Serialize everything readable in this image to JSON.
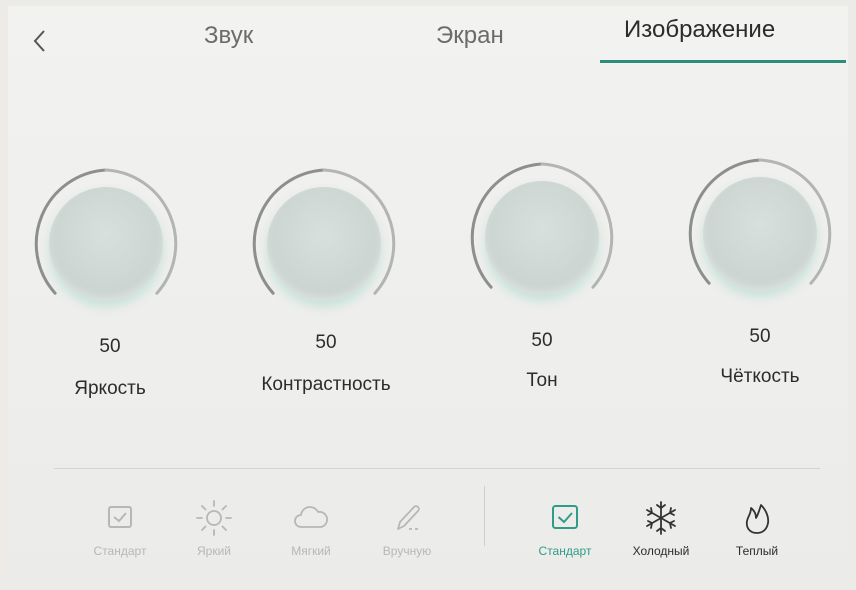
{
  "header": {
    "tabs": [
      {
        "label": "Звук",
        "active": false
      },
      {
        "label": "Экран",
        "active": false
      },
      {
        "label": "Изображение",
        "active": true
      }
    ]
  },
  "knobs": [
    {
      "label": "Яркость",
      "value": "50"
    },
    {
      "label": "Контрастность",
      "value": "50"
    },
    {
      "label": "Тон",
      "value": "50"
    },
    {
      "label": "Чёткость",
      "value": "50"
    }
  ],
  "picture_modes": [
    {
      "label": "Стандарт",
      "icon": "check-box-icon",
      "state": "disabled"
    },
    {
      "label": "Яркий",
      "icon": "sun-icon",
      "state": "disabled"
    },
    {
      "label": "Мягкий",
      "icon": "cloud-icon",
      "state": "disabled"
    },
    {
      "label": "Вручную",
      "icon": "pencil-icon",
      "state": "disabled"
    }
  ],
  "color_temps": [
    {
      "label": "Стандарт",
      "icon": "check-box-icon",
      "state": "selected"
    },
    {
      "label": "Холодный",
      "icon": "snowflake-icon",
      "state": "normal"
    },
    {
      "label": "Теплый",
      "icon": "flame-icon",
      "state": "normal"
    }
  ],
  "colors": {
    "accent": "#2e8c7a",
    "selected_text": "#2e9c86",
    "disabled": "#b7b7b5"
  }
}
